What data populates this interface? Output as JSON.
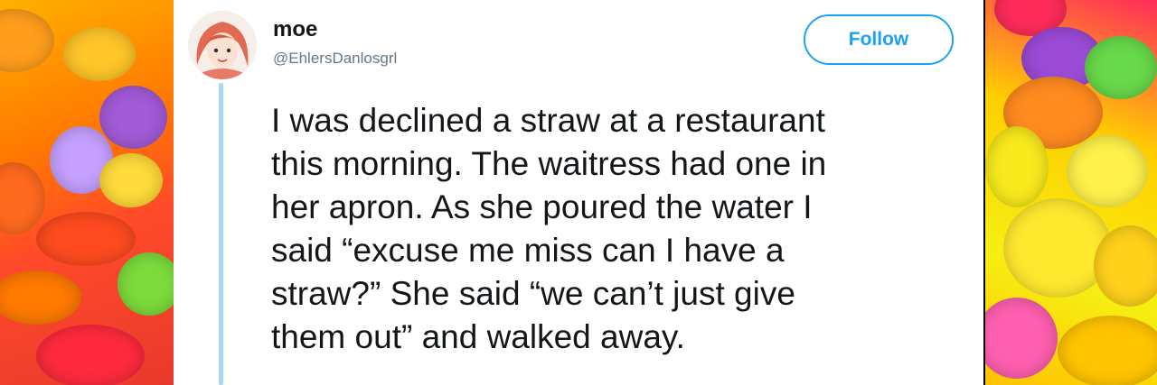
{
  "tweet": {
    "display_name": "moe",
    "handle": "@EhlersDanlosgrl",
    "follow_label": "Follow",
    "text_lines": [
      "I was declined a straw at a restaurant",
      "this morning. The waitress had one in",
      "her apron. As she poured the water I",
      "said “excuse me miss can I have a",
      "straw?” She said “we can’t just give",
      "them out” and walked away."
    ]
  },
  "colors": {
    "follow_accent": "#1da1f2",
    "thread_line": "#a9d7f6",
    "text": "#14171a",
    "handle": "#657786"
  },
  "icons": {
    "avatar": "illustrated-woman-avatar"
  }
}
